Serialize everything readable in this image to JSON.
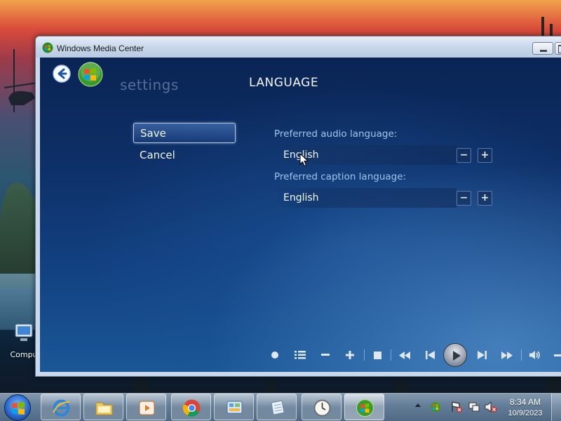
{
  "desktop": {
    "icons": [
      {
        "label": "Compu"
      }
    ]
  },
  "window": {
    "title": "Windows Media Center",
    "breadcrumb": "settings",
    "page_title": "LANGUAGE",
    "commands": [
      {
        "label": "Save",
        "selected": true
      },
      {
        "label": "Cancel",
        "selected": false
      }
    ],
    "options": {
      "audio": {
        "label": "Preferred audio language:",
        "value": "English"
      },
      "caption": {
        "label": "Preferred caption language:",
        "value": "English"
      }
    },
    "transport_controls": [
      "record-icon",
      "guide-icon",
      "volume-down-icon",
      "volume-up-icon",
      "stop-icon",
      "rewind-icon",
      "previous-icon",
      "play-icon",
      "next-icon",
      "fast-forward-icon",
      "mute-icon"
    ]
  },
  "taskbar": {
    "pinned_apps": [
      "internet-explorer-icon",
      "file-explorer-icon",
      "media-player-icon",
      "chrome-icon",
      "control-panel-icon",
      "notepad-icon",
      "clock-app-icon",
      "media-center-icon"
    ],
    "active_app": "media-center-icon",
    "tray_icons": [
      "action-center-icon",
      "network-error-icon",
      "display-icon",
      "volume-muted-icon"
    ],
    "time": "8:34 AM",
    "date": "10/9/2023"
  },
  "colors": {
    "mc_background": "#0e3068",
    "label_blue": "#9fc6ec",
    "text_white": "#f2f6ff"
  }
}
